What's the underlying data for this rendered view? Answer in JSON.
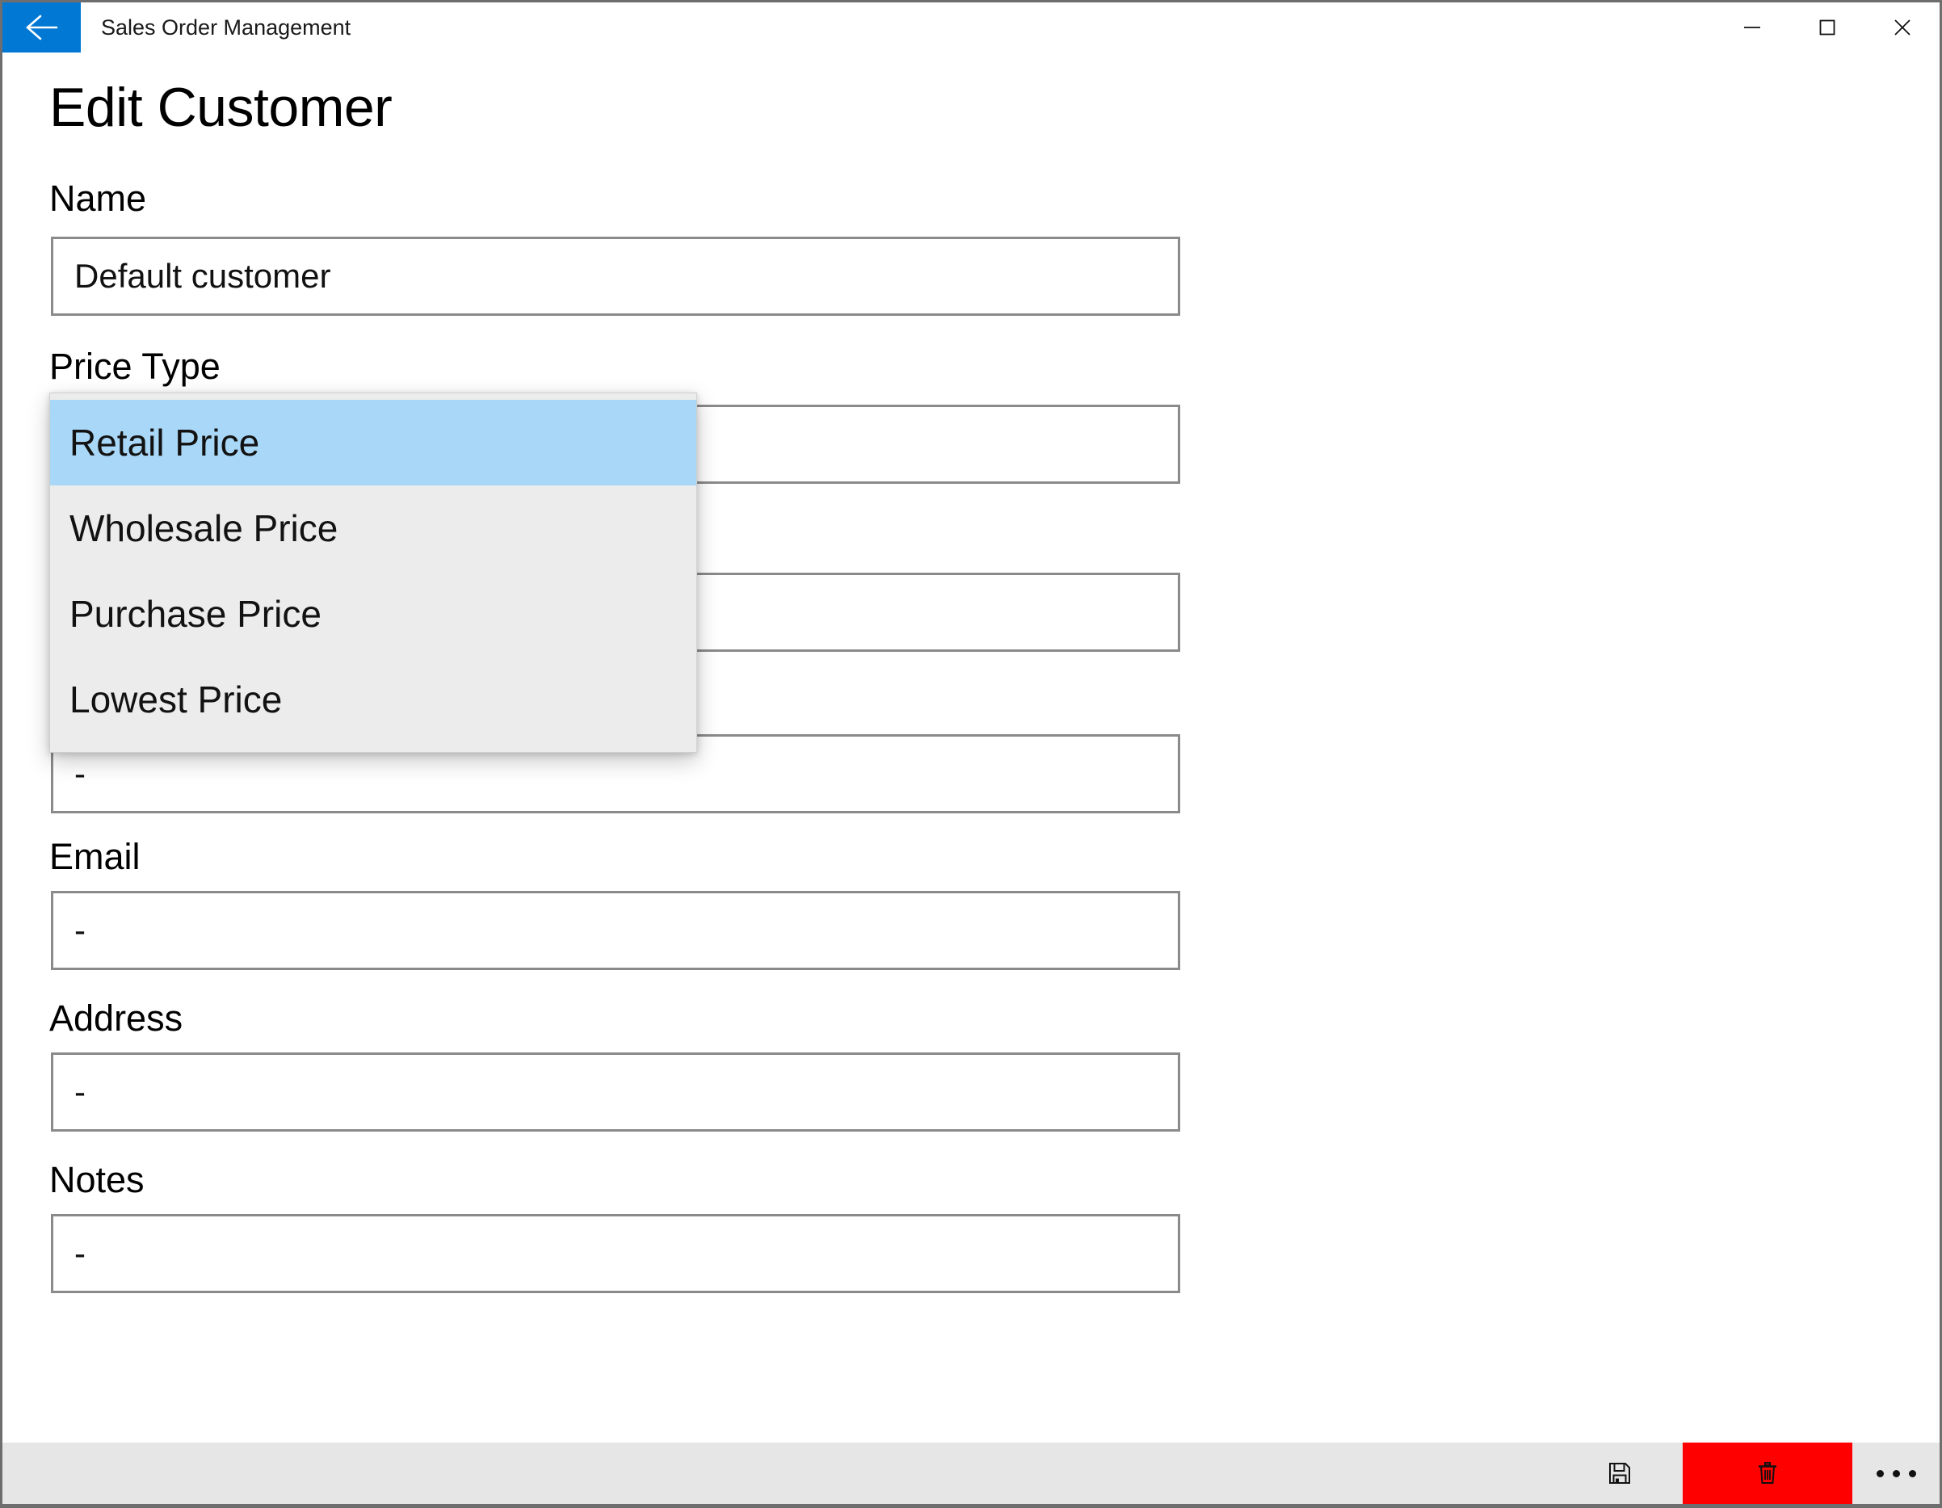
{
  "window": {
    "app_title": "Sales Order Management",
    "back_icon": "back-arrow-icon",
    "controls": {
      "minimize": "minimize-icon",
      "maximize": "maximize-icon",
      "close": "close-icon"
    }
  },
  "page": {
    "title": "Edit Customer"
  },
  "form": {
    "fields": [
      {
        "label": "Name",
        "value": "Default customer"
      },
      {
        "label": "Price Type",
        "value": ""
      },
      {
        "label": "",
        "value": ""
      },
      {
        "label": "",
        "value": "-"
      },
      {
        "label": "Email",
        "value": "-"
      },
      {
        "label": "Address",
        "value": "-"
      },
      {
        "label": "Notes",
        "value": "-"
      }
    ]
  },
  "dropdown": {
    "open": true,
    "selected": "Retail Price",
    "highlight_color": "#a9d7f7",
    "items": [
      "Retail Price",
      "Wholesale Price",
      "Purchase Price",
      "Lowest Price"
    ]
  },
  "commandbar": {
    "save": {
      "icon": "save-floppy-icon",
      "label": "Save"
    },
    "delete": {
      "icon": "delete-trash-icon",
      "label": "Delete",
      "color": "#ff0000"
    },
    "more": {
      "icon": "more-ellipsis-icon",
      "label": "See more"
    }
  },
  "colors": {
    "accent": "#0078d4",
    "danger": "#ff0000",
    "commandbar_bg": "#e6e6e6",
    "dropdown_bg": "#ececec",
    "field_border": "#8a8a8a"
  }
}
